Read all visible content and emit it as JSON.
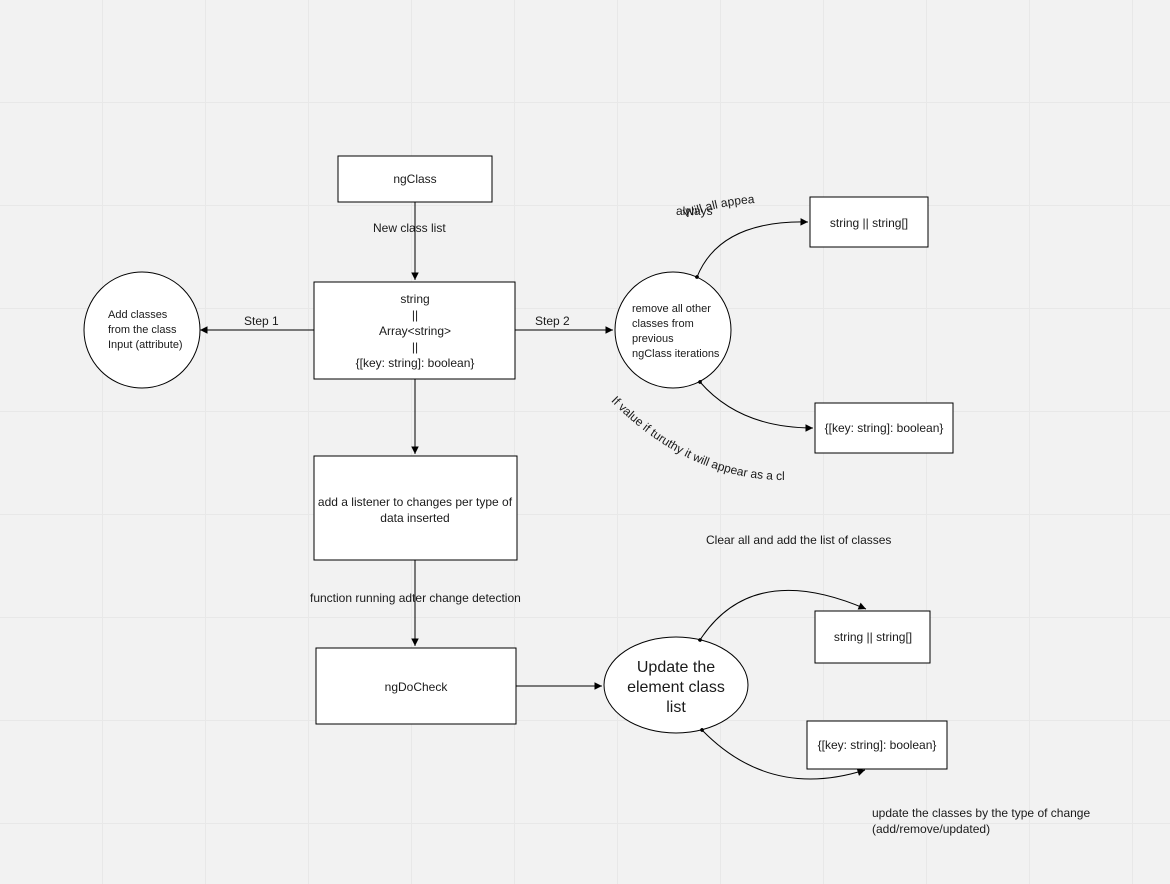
{
  "nodes": {
    "ngClass": "ngClass",
    "types_l1": "string",
    "types_l2": "||",
    "types_l3": "Array<string>",
    "types_l4": "||",
    "types_l5": "{[key: string]: boolean}",
    "addInputCircle_l1": "Add classes",
    "addInputCircle_l2": "from the class",
    "addInputCircle_l3": "Input (attribute)",
    "removeCircle_l1": "remove all other",
    "removeCircle_l2": "classes from",
    "removeCircle_l3": "previous",
    "removeCircle_l4": "ngClass iterations",
    "stringOrArr1": "string || string[]",
    "keyBool1": "{[key: string]: boolean}",
    "listener_l1": "add a listener to changes per type of",
    "listener_l2": "data inserted",
    "ngDoCheck": "ngDoCheck",
    "updateEllipse_l1": "Update the",
    "updateEllipse_l2": "element class",
    "updateEllipse_l3": "list",
    "stringOrArr2": "string || string[]",
    "keyBool2": "{[key: string]: boolean}"
  },
  "edgeLabels": {
    "newClassList": "New class list",
    "step1": "Step 1",
    "step2": "Step  2",
    "alwaysAppear_l1": "Will all appear as a class",
    "alwaysAppear_l2": "always",
    "ifTruthy": "If value if turuthy it will appear as a class",
    "afterCD": "function running adter change detection",
    "clearAll": "Clear all and add the list of classes",
    "updateByType_l1": "update the classes by the type of change",
    "updateByType_l2": "(add/remove/updated)"
  }
}
